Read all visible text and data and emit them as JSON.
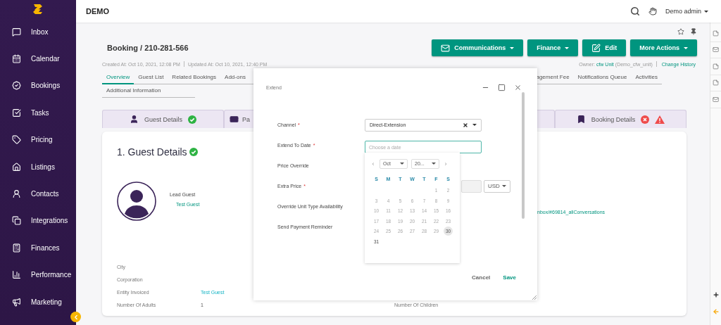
{
  "sidebar": {
    "items": [
      {
        "label": "Inbox"
      },
      {
        "label": "Calendar"
      },
      {
        "label": "Bookings"
      },
      {
        "label": "Tasks"
      },
      {
        "label": "Pricing"
      },
      {
        "label": "Listings"
      },
      {
        "label": "Contacts"
      },
      {
        "label": "Integrations"
      },
      {
        "label": "Finances"
      },
      {
        "label": "Performance"
      },
      {
        "label": "Marketing"
      }
    ]
  },
  "topbar": {
    "title": "DEMO",
    "user": "Demo admin"
  },
  "booking": {
    "title": "Booking / 210-281-566",
    "created": "Created At: Oct 10, 2021, 12:08 PM",
    "updated": "Updated At: Oct 10, 2021, 12:40 PM",
    "owner_label": "Owner:",
    "owner": "cfw Unit",
    "owner_code": "(Demo_cfw_unit)",
    "change_history": "Change History"
  },
  "actions": [
    {
      "label": "Communications",
      "caret": true
    },
    {
      "label": "Finance",
      "caret": true
    },
    {
      "label": "Edit",
      "caret": false
    },
    {
      "label": "More Actions",
      "caret": true
    }
  ],
  "tabs": {
    "row_1_start": [
      {
        "label": "Overview",
        "selected": true
      },
      {
        "label": "Guest List",
        "selected": false
      },
      {
        "label": "Related Bookings",
        "selected": false
      },
      {
        "label": "Add-ons",
        "selected": false
      }
    ],
    "row_1_end": [
      {
        "label": "agement Fee",
        "selected": false
      },
      {
        "label": "Notifications Queue",
        "selected": false
      },
      {
        "label": "Activities",
        "selected": false
      }
    ],
    "row_2": [
      {
        "label": "Additional Information",
        "selected": false
      }
    ]
  },
  "steps": [
    {
      "label": "Guest Details",
      "complete": true,
      "error": false
    },
    {
      "label": "Pa"
    },
    {
      "label": "Booking Details",
      "complete": false,
      "error": true
    }
  ],
  "guest_details": {
    "title": "1. Guest Details",
    "complete": true,
    "lead_guest_label": "Lead Guest",
    "lead_guest": "Test Guest",
    "conversation_link": "nbox/#69814_allConversations",
    "fields": [
      {
        "label": "City"
      },
      {
        "label": "Corporation"
      },
      {
        "label": "Entity Invoiced",
        "value": "Test Guest",
        "link": true
      },
      {
        "label": "Number Of Adults",
        "value": "1",
        "link": false,
        "second_label": "Number Of Children"
      }
    ]
  },
  "extend_dialog": {
    "title": "Extend",
    "fields": [
      {
        "kind": "select",
        "label": "Channel",
        "required_mark": "*",
        "value": "Direct-Extension"
      },
      {
        "kind": "date",
        "label": "Extend To Date",
        "required_mark": "*",
        "placeholder": "Choose a date",
        "focused": true
      },
      {
        "kind": "plain",
        "label": "Price Override"
      },
      {
        "kind": "price",
        "label": "Extra Price",
        "required_mark": "*",
        "currency": "USD"
      },
      {
        "kind": "plain",
        "label": "Override Unit Type Availability"
      },
      {
        "kind": "plain",
        "label": "Send Payment Reminder"
      }
    ],
    "datepicker": {
      "prev": "‹",
      "next": "›",
      "month": "Oct",
      "year": "20...",
      "weekdays": [
        "S",
        "M",
        "T",
        "W",
        "T",
        "F",
        "S"
      ],
      "weeks": [
        [
          {
            "label": "1",
            "disabled": true,
            "today": false
          },
          {
            "label": "2",
            "disabled": true,
            "today": false
          }
        ],
        [
          {
            "label": "3",
            "disabled": true,
            "today": false
          },
          {
            "label": "4",
            "disabled": true,
            "today": false
          },
          {
            "label": "5",
            "disabled": true,
            "today": false
          },
          {
            "label": "6",
            "disabled": true,
            "today": false
          },
          {
            "label": "7",
            "disabled": true,
            "today": false
          },
          {
            "label": "8",
            "disabled": true,
            "today": false
          },
          {
            "label": "9",
            "disabled": true,
            "today": false
          }
        ],
        [
          {
            "label": "10",
            "disabled": true,
            "today": false
          },
          {
            "label": "11",
            "disabled": true,
            "today": false
          },
          {
            "label": "12",
            "disabled": true,
            "today": false
          },
          {
            "label": "13",
            "disabled": true,
            "today": false
          },
          {
            "label": "14",
            "disabled": true,
            "today": false
          },
          {
            "label": "15",
            "disabled": true,
            "today": false
          },
          {
            "label": "16",
            "disabled": true,
            "today": false
          }
        ],
        [
          {
            "label": "17",
            "disabled": true,
            "today": false
          },
          {
            "label": "18",
            "disabled": true,
            "today": false
          },
          {
            "label": "19",
            "disabled": true,
            "today": false
          },
          {
            "label": "20",
            "disabled": true,
            "today": false
          },
          {
            "label": "21",
            "disabled": true,
            "today": false
          },
          {
            "label": "22",
            "disabled": true,
            "today": false
          },
          {
            "label": "23",
            "disabled": true,
            "today": false
          }
        ],
        [
          {
            "label": "24",
            "disabled": true,
            "today": false
          },
          {
            "label": "25",
            "disabled": true,
            "today": false
          },
          {
            "label": "26",
            "disabled": true,
            "today": false
          },
          {
            "label": "27",
            "disabled": true,
            "today": false
          },
          {
            "label": "28",
            "disabled": true,
            "today": false
          },
          {
            "label": "29",
            "disabled": true,
            "today": false
          },
          {
            "label": "30",
            "disabled": true,
            "today": true
          }
        ],
        [
          {
            "label": "31",
            "disabled": false,
            "today": false
          }
        ]
      ]
    },
    "buttons": [
      {
        "label": "Cancel",
        "kind": "secondary"
      },
      {
        "label": "Save",
        "kind": "primary"
      }
    ]
  }
}
